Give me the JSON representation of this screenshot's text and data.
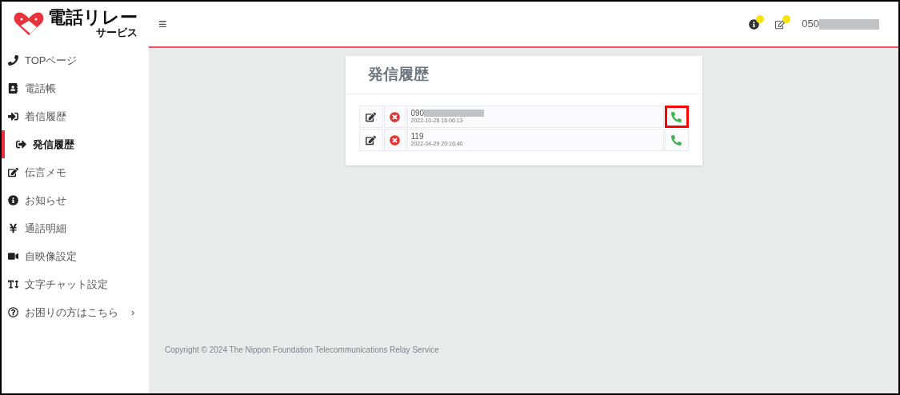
{
  "logo": {
    "main": "電話リレー",
    "sub": "サービス"
  },
  "header": {
    "menu_glyph": "≡",
    "info_badge": true,
    "memo_badge": true,
    "phone_number": "050",
    "phone_masked": true
  },
  "sidebar": {
    "items": [
      {
        "kind": "phone",
        "label": "TOPページ",
        "selected": false
      },
      {
        "kind": "contacts",
        "label": "電話帳",
        "selected": false
      },
      {
        "kind": "incoming",
        "label": "着信履歴",
        "selected": false
      },
      {
        "kind": "outgoing",
        "label": "発信履歴",
        "selected": true
      },
      {
        "kind": "memo",
        "label": "伝言メモ",
        "selected": false
      },
      {
        "kind": "info",
        "label": "お知らせ",
        "selected": false
      },
      {
        "kind": "yen",
        "label": "通話明細",
        "selected": false
      },
      {
        "kind": "video",
        "label": "自映像設定",
        "selected": false
      },
      {
        "kind": "text",
        "label": "文字チャット設定",
        "selected": false
      },
      {
        "kind": "help",
        "label": "お困りの方はこちら",
        "selected": false,
        "chevron": "›"
      }
    ]
  },
  "card": {
    "title": "発信履歴",
    "rows": [
      {
        "number": "090",
        "masked": true,
        "datetime": "2022-10-28 16:06:13",
        "highlighted": true
      },
      {
        "number": "119",
        "masked": false,
        "datetime": "2022-04-29 20:16:40",
        "highlighted": false
      }
    ]
  },
  "footer": "Copyright © 2024 The Nippon Foundation Telecommunications Relay Service"
}
